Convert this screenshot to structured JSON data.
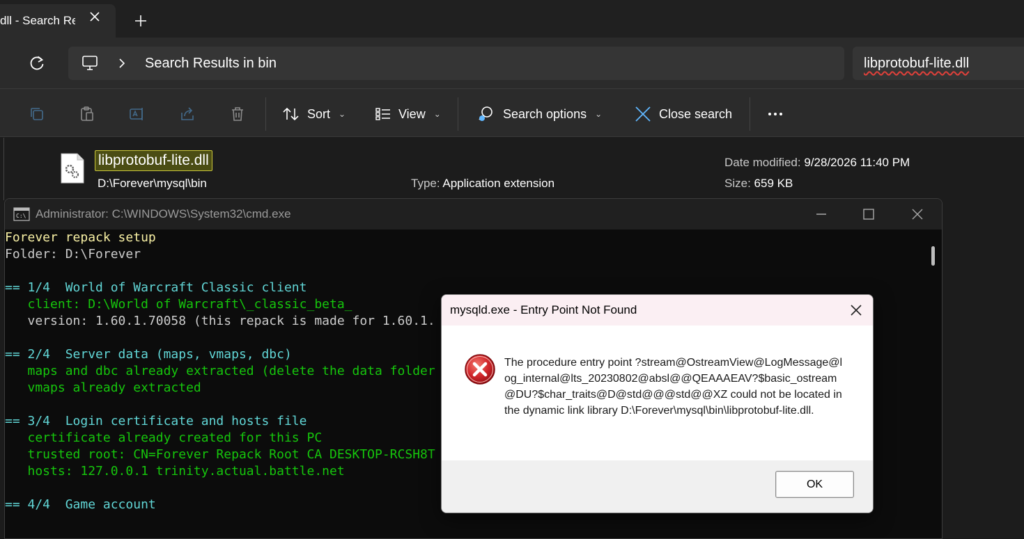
{
  "explorer": {
    "tab_title": "dll - Search Re",
    "address": "Search Results in bin",
    "search_value": "libprotobuf-lite.dll",
    "toolbar": {
      "sort": "Sort",
      "view": "View",
      "search_options": "Search options",
      "close_search": "Close search"
    },
    "file": {
      "name": "libprotobuf-lite.dll",
      "path": "D:\\Forever\\mysql\\bin",
      "type_label": "Type:",
      "type_value": "Application extension",
      "date_label": "Date modified:",
      "date_value": "9/28/2026 11:40 PM",
      "size_label": "Size:",
      "size_value": "659 KB"
    }
  },
  "cmd": {
    "title": "Administrator: C:\\WINDOWS\\System32\\cmd.exe",
    "lines": [
      {
        "text": "Forever repack setup",
        "color": "yellow"
      },
      {
        "text": "Folder: D:\\Forever",
        "color": "white"
      },
      {
        "text": "",
        "color": "white"
      },
      {
        "text": "== 1/4  World of Warcraft Classic client",
        "color": "cyan"
      },
      {
        "text": "   client: D:\\World of Warcraft\\_classic_beta_",
        "color": "green"
      },
      {
        "text": "   version: 1.60.1.70058 (this repack is made for 1.60.1.",
        "color": "gray"
      },
      {
        "text": "",
        "color": "white"
      },
      {
        "text": "== 2/4  Server data (maps, vmaps, dbc)",
        "color": "cyan"
      },
      {
        "text": "   maps and dbc already extracted (delete the data folder",
        "color": "green"
      },
      {
        "text": "   vmaps already extracted",
        "color": "green"
      },
      {
        "text": "",
        "color": "white"
      },
      {
        "text": "== 3/4  Login certificate and hosts file",
        "color": "cyan"
      },
      {
        "text": "   certificate already created for this PC",
        "color": "green"
      },
      {
        "text": "   trusted root: CN=Forever Repack Root CA DESKTOP-RCSH8T",
        "color": "green"
      },
      {
        "text": "   hosts: 127.0.0.1 trinity.actual.battle.net",
        "color": "green"
      },
      {
        "text": "",
        "color": "white"
      },
      {
        "text": "== 4/4  Game account",
        "color": "cyan"
      }
    ]
  },
  "dialog": {
    "title": "mysqld.exe - Entry Point Not Found",
    "message": "The procedure entry point ?stream@OstreamView@LogMessage@log_internal@lts_20230802@absl@@QEAAAEAV?$basic_ostream@DU?$char_traits@D@std@@@std@@XZ could not be located in the dynamic link library D:\\Forever\\mysql\\bin\\libprotobuf-lite.dll.",
    "ok_label": "OK",
    "icon": "error-icon"
  }
}
